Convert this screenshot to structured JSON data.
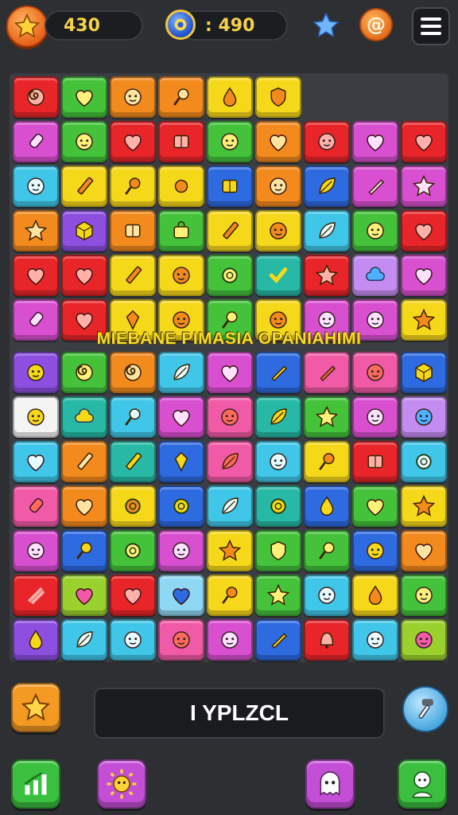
{
  "top": {
    "stars": "430",
    "coins": ": 490",
    "icons": [
      "star-icon",
      "coin-icon",
      "blue-star-icon",
      "at-icon",
      "menu-icon"
    ],
    "at_symbol": "@"
  },
  "banner": "MIEBANE  PIMASIA  OPANIAHIMI",
  "bottom": {
    "label": "I YPLZCL",
    "buttons": [
      "star-button",
      "hint-button",
      "stats-button",
      "sun-button",
      "ghost-button",
      "character-button"
    ]
  },
  "colors": {
    "red": "#e8262a",
    "green": "#43c23a",
    "orange": "#f28a1e",
    "yellow": "#f6d81b",
    "magenta": "#d84fd0",
    "cyan": "#3fc6e8",
    "blue": "#2e6be0",
    "teal": "#27b9a5",
    "lime": "#9bd12e",
    "pink": "#f15aa6",
    "purple": "#8c4fe0",
    "lightblue": "#8fd8f4",
    "lavender": "#c48cf0",
    "white": "#f4f4f4"
  },
  "board": {
    "rows_top": [
      [
        "red:spiral",
        "green:heart",
        "orange:face",
        "orange:pin",
        "yellow:drop",
        "yellow:shield"
      ],
      [
        "magenta:candy",
        "green:face",
        "red:heart",
        "red:box",
        "green:face",
        "orange:heart",
        "red:face",
        "magenta:heart",
        "red:heart"
      ],
      [
        "cyan:face",
        "yellow:pencil",
        "yellow:pin",
        "yellow:dot",
        "blue:box",
        "orange:face",
        "blue:leaf",
        "magenta:brush",
        "magenta:star"
      ],
      [
        "orange:star",
        "purple:cube",
        "orange:box",
        "green:bag",
        "yellow:pencil",
        "yellow:face",
        "cyan:leaf",
        "green:face",
        "red:heart"
      ],
      [
        "red:heart",
        "red:heart",
        "yellow:pencil",
        "yellow:face",
        "green:ring",
        "teal:check",
        "red:star",
        "lavender:cloud",
        "magenta:heart"
      ],
      [
        "magenta:candy",
        "red:heart",
        "yellow:gem",
        "yellow:face",
        "green:pin",
        "yellow:face",
        "magenta:face",
        "magenta:face",
        "yellow:star"
      ]
    ],
    "rows_bottom": [
      [
        "purple:face",
        "green:spiral",
        "orange:spiral",
        "cyan:leaf",
        "magenta:heart",
        "blue:brush",
        "pink:brush",
        "pink:face",
        "blue:cube"
      ],
      [
        "white:face",
        "teal:cloud",
        "cyan:pin",
        "magenta:heart",
        "pink:face",
        "teal:leaf",
        "green:star",
        "magenta:face",
        "lavender:face"
      ],
      [
        "cyan:heart",
        "orange:pencil",
        "teal:pencil",
        "blue:gem",
        "pink:leaf",
        "cyan:face",
        "yellow:pin",
        "red:box",
        "cyan:ring"
      ],
      [
        "pink:candy",
        "orange:heart",
        "yellow:ring",
        "blue:ring",
        "cyan:leaf",
        "teal:ring",
        "blue:drop",
        "green:heart",
        "yellow:star"
      ],
      [
        "magenta:face",
        "blue:pin",
        "green:ring",
        "magenta:face",
        "yellow:star",
        "green:shield",
        "green:pin",
        "blue:face",
        "orange:heart"
      ],
      [
        "red:sticks",
        "lime:heart",
        "red:heart",
        "lightblue:heart",
        "yellow:pin",
        "green:star",
        "cyan:face",
        "yellow:drop",
        "green:face"
      ],
      [
        "purple:drop",
        "cyan:leaf",
        "cyan:face",
        "pink:face",
        "magenta:face",
        "blue:brush",
        "red:bell",
        "cyan:face",
        "lime:face"
      ]
    ]
  }
}
